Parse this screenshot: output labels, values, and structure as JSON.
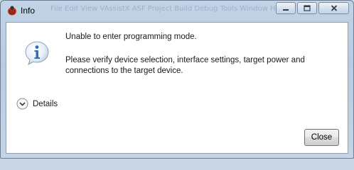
{
  "window": {
    "title": "Info",
    "background_menu_ghost": "File   Edit   View   VAssistX   ASF   Project   Build   Debug   Tools   Window   Help"
  },
  "message": {
    "line1": "Unable to enter programming mode.",
    "line2": "Please verify device selection, interface settings, target power and connections to the target device."
  },
  "details": {
    "label": "Details"
  },
  "buttons": {
    "close_label": "Close"
  },
  "icons": {
    "app": "ladybug-icon",
    "info": "info-icon",
    "details": "chevron-down-circle-icon",
    "minimize": "minimize-icon",
    "maximize": "maximize-icon",
    "close": "close-icon"
  },
  "colors": {
    "info_blue": "#2f6fb5",
    "client_bg": "#ffffff",
    "frame": "#b8cbe0"
  }
}
